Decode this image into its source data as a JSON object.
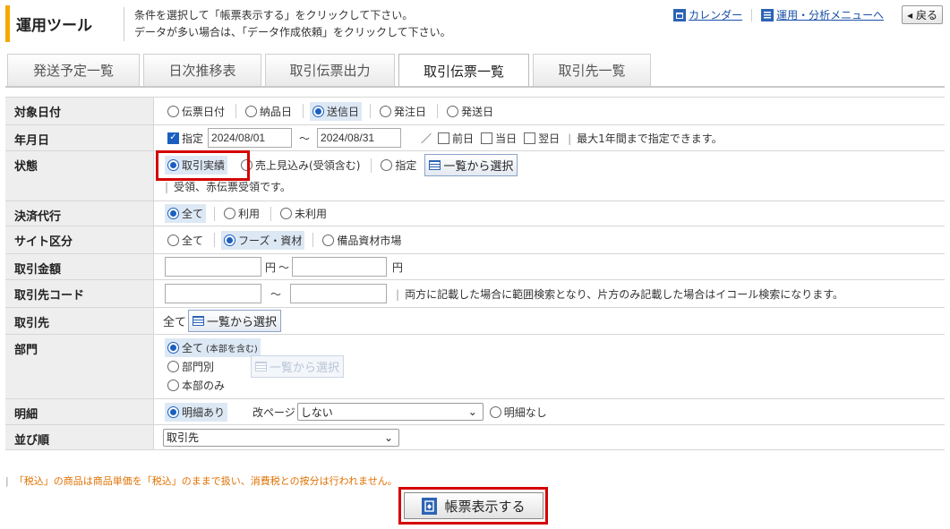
{
  "header": {
    "title": "運用ツール",
    "desc1": "条件を選択して「帳票表示する」をクリックして下さい。",
    "desc2": "データが多い場合は、「データ作成依頼」をクリックして下さい。",
    "calendar_link": "カレンダー",
    "menu_link": "運用・分析メニューへ",
    "back_label": "戻る"
  },
  "tabs": [
    "発送予定一覧",
    "日次推移表",
    "取引伝票出力",
    "取引伝票一覧",
    "取引先一覧"
  ],
  "active_tab": "取引伝票一覧",
  "form": {
    "target_date": {
      "label": "対象日付",
      "options": [
        "伝票日付",
        "納品日",
        "送信日",
        "発注日",
        "発送日"
      ],
      "selected": "送信日"
    },
    "year_month": {
      "label": "年月日",
      "specify_label": "指定",
      "from": "2024/08/01",
      "tilde": "～",
      "to": "2024/08/31",
      "slash": "／",
      "prev_day": "前日",
      "today": "当日",
      "next_day": "翌日",
      "note": "最大1年間まで指定できます。"
    },
    "status": {
      "label": "状態",
      "opt_actual": "取引実績",
      "opt_forecast": "売上見込み(受領含む)",
      "opt_specify": "指定",
      "pick_label": "一覧から選択",
      "note": "受領、赤伝票受領です。",
      "selected": "取引実績"
    },
    "settlement": {
      "label": "決済代行",
      "options": [
        "全て",
        "利用",
        "未利用"
      ],
      "selected": "全て"
    },
    "site": {
      "label": "サイト区分",
      "options": [
        "全て",
        "フーズ・資材",
        "備品資材市場"
      ],
      "selected": "フーズ・資材"
    },
    "amount": {
      "label": "取引金額",
      "unit": "円",
      "tilde": "～",
      "from": "",
      "to": ""
    },
    "partner_code": {
      "label": "取引先コード",
      "tilde": "～",
      "from": "",
      "to": "",
      "note": "両方に記載した場合に範囲検索となり、片方のみ記載した場合はイコール検索になります。"
    },
    "partner": {
      "label": "取引先",
      "value": "全て",
      "pick_label": "一覧から選択"
    },
    "department": {
      "label": "部門",
      "opt_all": "全て",
      "opt_all_sub": "(本部を含む)",
      "opt_each": "部門別",
      "opt_hq": "本部のみ",
      "pick_label": "一覧から選択",
      "selected": "全て"
    },
    "detail": {
      "label": "明細",
      "opt_with": "明細あり",
      "page_break_label": "改ページ",
      "page_break_value": "しない",
      "opt_without": "明細なし",
      "selected": "明細あり"
    },
    "sort": {
      "label": "並び順",
      "value": "取引先"
    }
  },
  "tax_note": "「税込」の商品は商品単価を「税込」のままで扱い、消費税との按分は行われません。",
  "submit_label": "帳票表示する",
  "colors": {
    "accent": "#f5a800",
    "highlight": "#d40000",
    "link": "#1a4fa8",
    "label_bg": "#eeeeee"
  }
}
